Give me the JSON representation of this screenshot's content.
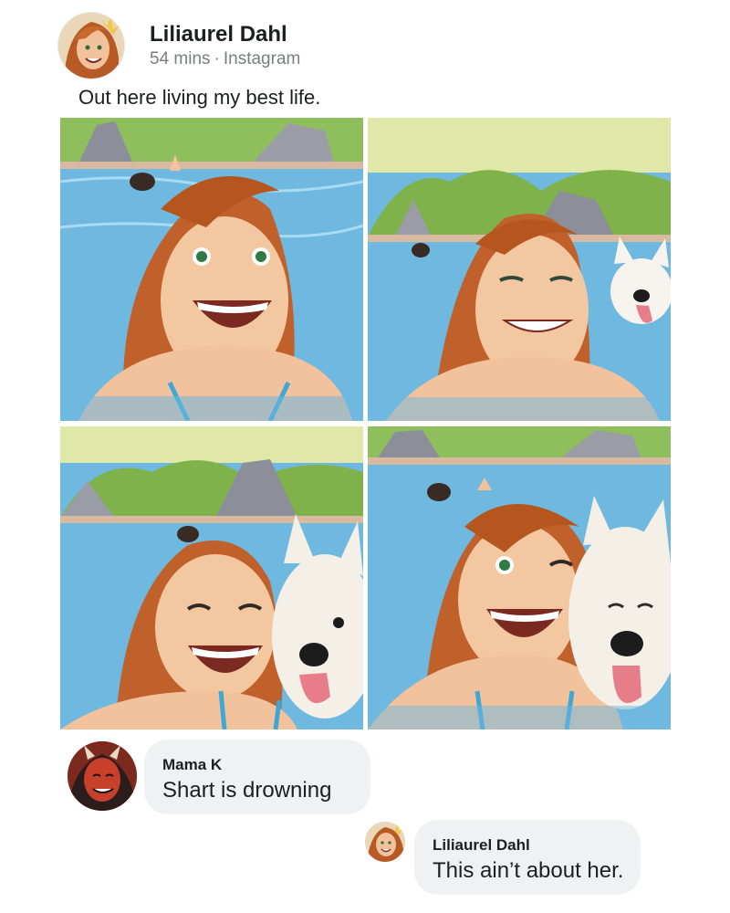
{
  "post": {
    "author": "Liliaurel Dahl",
    "time": "54 mins",
    "source": "Instagram",
    "text": "Out here living my best life."
  },
  "photos": [
    {
      "name": "selfie-1"
    },
    {
      "name": "selfie-2"
    },
    {
      "name": "selfie-3"
    },
    {
      "name": "selfie-4"
    }
  ],
  "comments": [
    {
      "author": "Mama K",
      "text": "Shart is drowning"
    },
    {
      "author": "Liliaurel Dahl",
      "text": "This ain’t about her."
    }
  ],
  "colors": {
    "bubble": "#eff1f2",
    "meta_text": "#7a7d82",
    "water": "#7fc4e6",
    "grass": "#9ec26a",
    "hair": "#c0602a"
  }
}
